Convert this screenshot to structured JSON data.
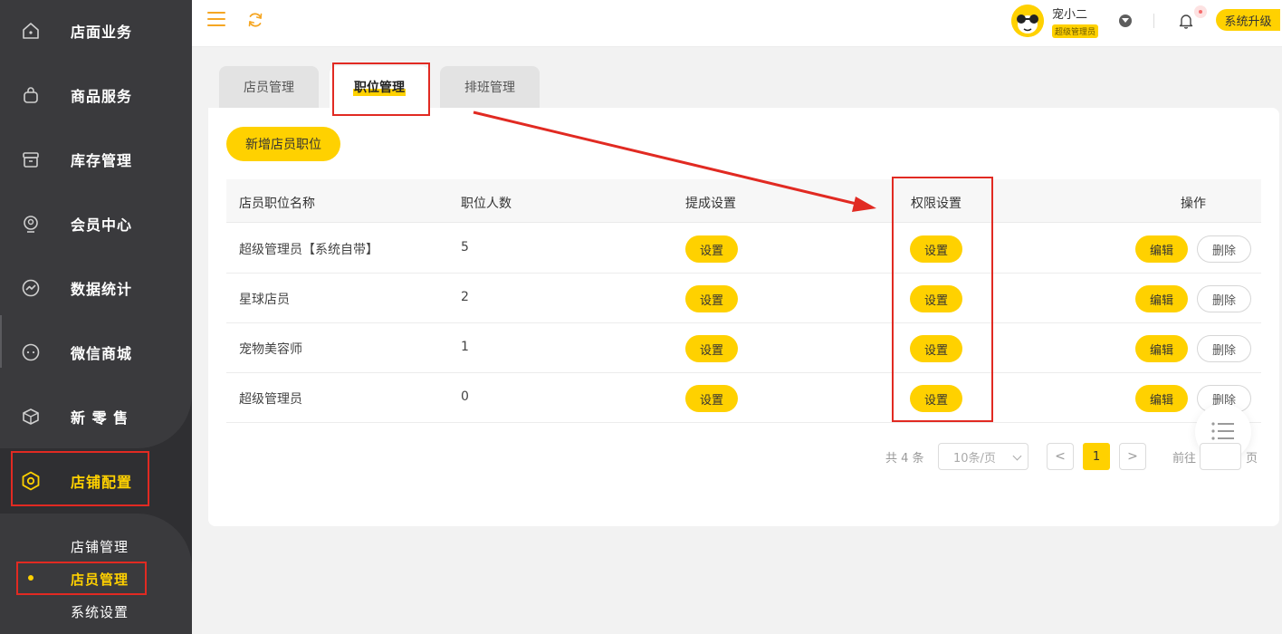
{
  "sidebar": {
    "items": [
      {
        "label": "店面业务",
        "icon": "home-icon"
      },
      {
        "label": "商品服务",
        "icon": "bag-icon"
      },
      {
        "label": "库存管理",
        "icon": "box-icon"
      },
      {
        "label": "会员中心",
        "icon": "user-icon"
      },
      {
        "label": "数据统计",
        "icon": "chart-icon"
      },
      {
        "label": "微信商城",
        "icon": "chat-icon"
      },
      {
        "label": "新 零 售",
        "icon": "cube-icon"
      },
      {
        "label": "店铺配置",
        "icon": "settings-icon"
      }
    ],
    "sub_items": [
      {
        "label": "店铺管理"
      },
      {
        "label": "店员管理"
      },
      {
        "label": "系统设置"
      }
    ]
  },
  "header": {
    "user_name": "宠小二",
    "user_role": "超级管理员",
    "upgrade_label": "系统升级"
  },
  "tabs": [
    {
      "label": "店员管理"
    },
    {
      "label": "职位管理"
    },
    {
      "label": "排班管理"
    }
  ],
  "add_button": "新增店员职位",
  "table": {
    "columns": [
      "店员职位名称",
      "职位人数",
      "提成设置",
      "权限设置",
      "操作"
    ],
    "rows": [
      {
        "name": "超级管理员【系统自带】",
        "count": "5",
        "commission": "设置",
        "permission": "设置",
        "edit": "编辑",
        "delete": "删除"
      },
      {
        "name": "星球店员",
        "count": "2",
        "commission": "设置",
        "permission": "设置",
        "edit": "编辑",
        "delete": "删除"
      },
      {
        "name": "宠物美容师",
        "count": "1",
        "commission": "设置",
        "permission": "设置",
        "edit": "编辑",
        "delete": "删除"
      },
      {
        "name": "超级管理员",
        "count": "0",
        "commission": "设置",
        "permission": "设置",
        "edit": "编辑",
        "delete": "删除"
      }
    ]
  },
  "pagination": {
    "total": "共 4 条",
    "page_size": "10条/页",
    "prev": "<",
    "current": "1",
    "next": ">",
    "goto_label": "前往",
    "goto_value": "",
    "unit": "页"
  },
  "colors": {
    "accent": "#ffd100",
    "sidebar_bg": "#2f2f32",
    "annotation": "#e12a22"
  }
}
